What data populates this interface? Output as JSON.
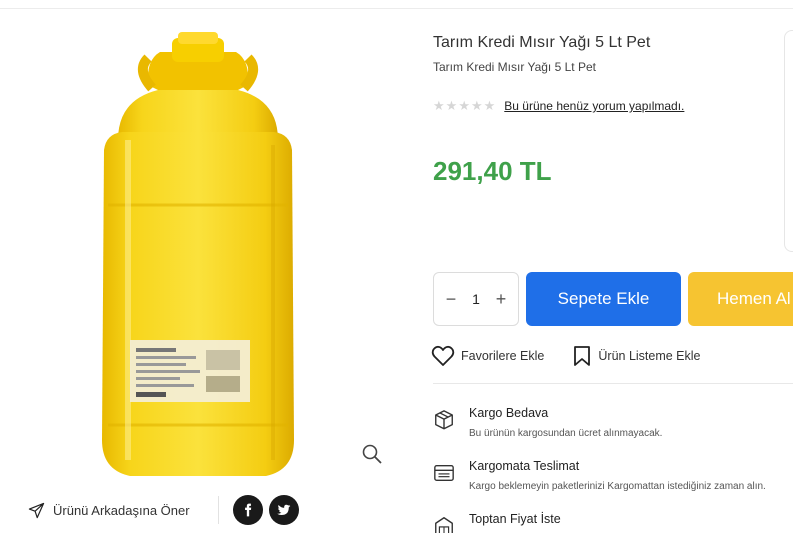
{
  "product": {
    "title": "Tarım Kredi Mısır Yağı 5 Lt Pet",
    "subtitle": "Tarım Kredi Mısır Yağı 5 Lt Pet",
    "rating_stars": 0,
    "review_text": "Bu ürüne henüz yorum yapılmadı.",
    "price": "291,40 TL"
  },
  "share": {
    "label": "Ürünü Arkadaşına Öner",
    "networks": [
      "facebook-icon",
      "twitter-icon"
    ]
  },
  "cart": {
    "quantity": "1",
    "minus": "−",
    "plus": "+",
    "add_to_cart": "Sepete Ekle",
    "buy_now": "Hemen Al"
  },
  "actions": {
    "favorite": "Favorilere Ekle",
    "list": "Ürün Listeme Ekle"
  },
  "features": [
    {
      "title": "Kargo Bedava",
      "desc": "Bu ürünün kargosundan ücret alınmayacak.",
      "icon": "box-icon"
    },
    {
      "title": "Kargomata Teslimat",
      "desc": "Kargo beklemeyin paketlerinizi Kargomattan istediğiniz zaman alın.",
      "icon": "locker-icon"
    },
    {
      "title": "Toptan Fiyat İste",
      "desc": "",
      "icon": "warehouse-icon"
    }
  ],
  "colors": {
    "price": "#3fa14a",
    "cart_button": "#1f6fe8",
    "buy_button": "#f6c431",
    "oil": "#f5d21a"
  }
}
